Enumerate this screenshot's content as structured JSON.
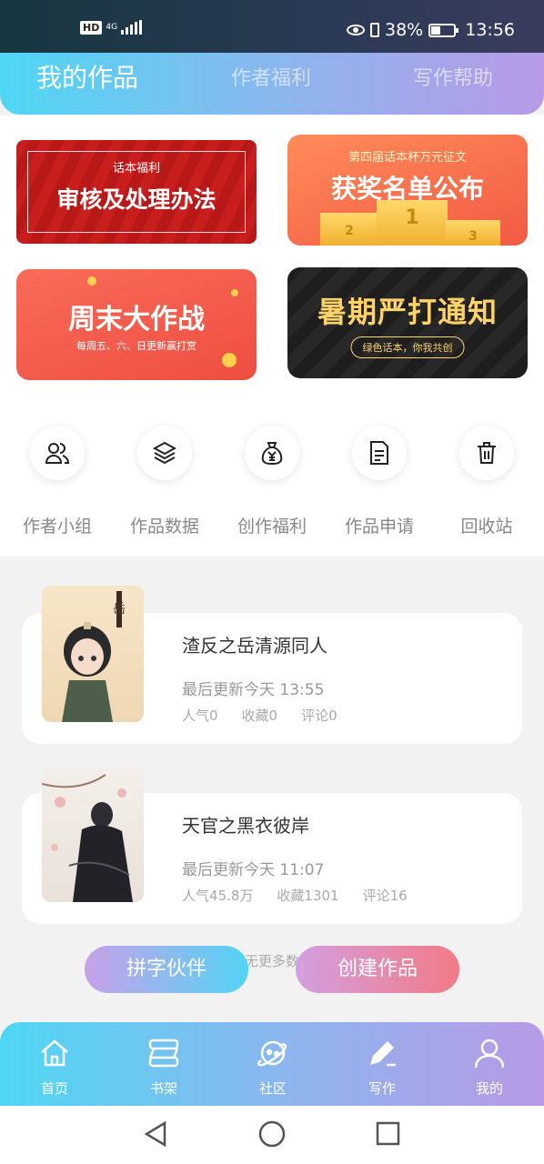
{
  "status_bar": {
    "hd": "HD",
    "network": "4G",
    "battery": "38%",
    "time": "13:56"
  },
  "header": {
    "tabs": [
      {
        "label": "我的作品",
        "active": true
      },
      {
        "label": "作者福利",
        "active": false
      },
      {
        "label": "写作帮助",
        "active": false
      }
    ]
  },
  "banners": [
    {
      "subtitle": "话本福利",
      "title": "审核及处理办法"
    },
    {
      "subtitle": "第四届话本杯万元征文",
      "title": "获奖名单公布",
      "podium": [
        "2",
        "1",
        "3"
      ]
    },
    {
      "title": "周末大作战",
      "subtitle": "每周五、六、日更新赢打赏"
    },
    {
      "title": "暑期严打通知",
      "subtitle": "绿色话本，你我共创"
    }
  ],
  "shortcuts": [
    {
      "label": "作者小组",
      "icon": "users-icon"
    },
    {
      "label": "作品数据",
      "icon": "layers-icon"
    },
    {
      "label": "创作福利",
      "icon": "money-bag-icon"
    },
    {
      "label": "作品申请",
      "icon": "document-icon"
    },
    {
      "label": "回收站",
      "icon": "trash-icon"
    }
  ],
  "works": [
    {
      "title": "渣反之岳清源同人",
      "updated": "最后更新今天 13:55",
      "popularity": "人气0",
      "favorites": "收藏0",
      "comments": "评论0"
    },
    {
      "title": "天官之黑衣彼岸",
      "updated": "最后更新今天 11:07",
      "popularity": "人气45.8万",
      "favorites": "收藏1301",
      "comments": "评论16"
    }
  ],
  "list_footer": "暂无更多数据",
  "actions": {
    "partner": "拼字伙伴",
    "create": "创建作品"
  },
  "bottom_nav": [
    {
      "label": "首页",
      "icon": "home-icon"
    },
    {
      "label": "书架",
      "icon": "bookshelf-icon"
    },
    {
      "label": "社区",
      "icon": "planet-icon"
    },
    {
      "label": "写作",
      "icon": "pen-icon",
      "active": true
    },
    {
      "label": "我的",
      "icon": "profile-icon"
    }
  ],
  "colors": {
    "header_gradient_start": "#4fd7f4",
    "header_gradient_end": "#b89ae6",
    "create_button": "#f27a86"
  }
}
